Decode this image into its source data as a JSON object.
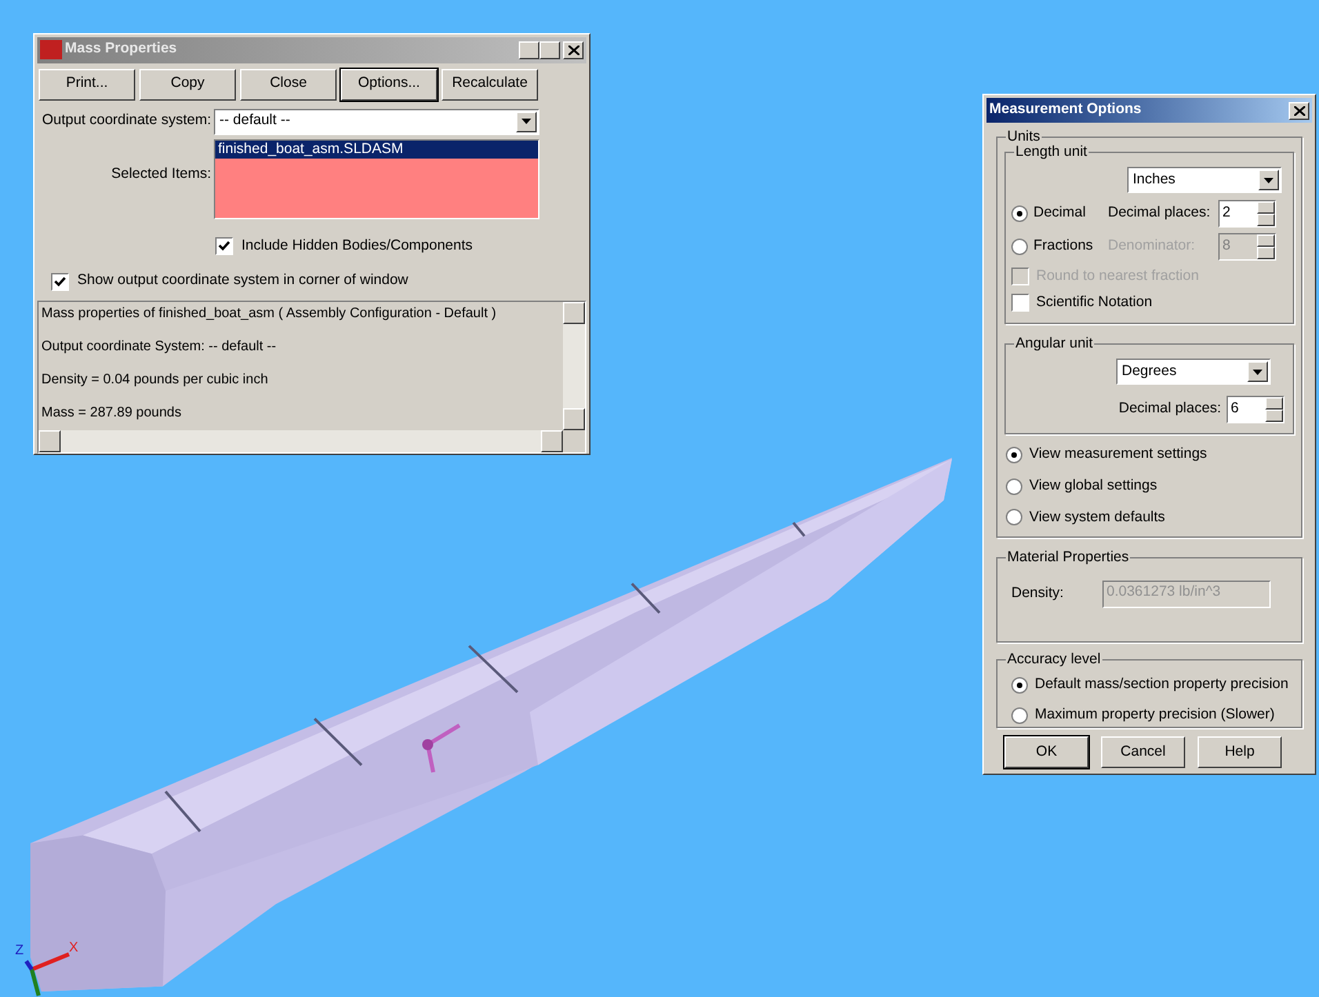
{
  "mass_properties": {
    "title": "Mass Properties",
    "active": false,
    "buttons": [
      {
        "label": "Print...",
        "focused": false
      },
      {
        "label": "Copy",
        "focused": false
      },
      {
        "label": "Close",
        "focused": false
      },
      {
        "label": "Options...",
        "focused": true
      },
      {
        "label": "Recalculate",
        "focused": false
      }
    ],
    "output_coordinate_system": {
      "label": "Output coordinate system:",
      "value": "-- default --"
    },
    "selected_items": {
      "label": "Selected Items:",
      "items": [
        {
          "text": "finished_boat_asm.SLDASM",
          "selected": true
        }
      ]
    },
    "include_hidden": {
      "label": "Include Hidden Bodies/Components",
      "checked": true
    },
    "show_output": {
      "label": "Show output coordinate system in corner of window",
      "checked": true
    },
    "results": [
      "Mass properties of finished_boat_asm ( Assembly Configuration - Default )",
      "Output  coordinate System: -- default --",
      "Density = 0.04 pounds per cubic inch",
      "Mass = 287.89 pounds"
    ]
  },
  "measurement_options": {
    "title": "Measurement Options",
    "active": true,
    "units": {
      "title": "Units",
      "length_unit": {
        "title": "Length unit",
        "value": "Inches",
        "rows": [
          {
            "kind": "radio",
            "label": "Decimal",
            "selected": true,
            "field_label": "Decimal places:",
            "field_value": "2",
            "disabled": false
          },
          {
            "kind": "radio",
            "label": "Fractions",
            "selected": false,
            "field_label": "Denominator:",
            "field_value": "8",
            "disabled": true
          },
          {
            "kind": "checkbox",
            "label": "Round to nearest fraction",
            "checked": false,
            "disabled": true
          },
          {
            "kind": "checkbox",
            "label": "Scientific Notation",
            "checked": false,
            "disabled": false
          }
        ]
      },
      "angular_unit": {
        "title": "Angular unit",
        "value": "Degrees",
        "field_label": "Decimal places:",
        "field_value": "6"
      },
      "views": [
        {
          "label": "View measurement settings",
          "selected": true
        },
        {
          "label": "View global settings",
          "selected": false
        },
        {
          "label": "View system defaults",
          "selected": false
        }
      ]
    },
    "material_properties": {
      "title": "Material Properties",
      "density_label": "Density:",
      "density_value": "0.0361273 lb/in^3"
    },
    "accuracy": {
      "title": "Accuracy level",
      "options": [
        {
          "label": "Default mass/section property precision",
          "selected": true
        },
        {
          "label": "Maximum property precision (Slower)",
          "selected": false
        }
      ]
    },
    "buttons": [
      {
        "label": "OK",
        "focused": true
      },
      {
        "label": "Cancel",
        "focused": false
      },
      {
        "label": "Help",
        "focused": false
      }
    ]
  },
  "viewport": {
    "axis_labels": [
      "Z",
      "X"
    ]
  }
}
